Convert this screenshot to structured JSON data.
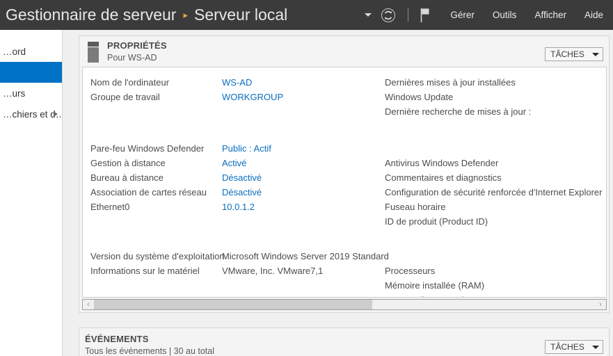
{
  "header": {
    "app_title": "Gestionnaire de serveur",
    "separator": "▸",
    "current_page": "Serveur local",
    "icons": {
      "caret": "chevron-down-icon",
      "refresh": "refresh-icon",
      "flag": "notifications-flag-icon"
    },
    "menu": [
      {
        "label": "Gérer"
      },
      {
        "label": "Outils"
      },
      {
        "label": "Afficher"
      },
      {
        "label": "Aide"
      }
    ]
  },
  "sidebar": {
    "items": [
      {
        "label": "…ord",
        "selected": false,
        "has_arrow": false
      },
      {
        "label": "",
        "selected": true,
        "has_arrow": false
      },
      {
        "label": "…urs",
        "selected": false,
        "has_arrow": false
      },
      {
        "label": "…chiers et d…",
        "selected": false,
        "has_arrow": true
      }
    ]
  },
  "properties_tile": {
    "title": "PROPRIÉTÉS",
    "subtitle": "Pour WS-AD",
    "tasks_label": "TÂCHES",
    "left_column": [
      [
        {
          "key": "Nom de l'ordinateur",
          "value": "WS-AD",
          "link": true
        },
        {
          "key": "Groupe de travail",
          "value": "WORKGROUP",
          "link": true
        }
      ],
      [
        {
          "key": "Pare-feu Windows Defender",
          "value": "Public : Actif",
          "link": true
        },
        {
          "key": "Gestion à distance",
          "value": "Activé",
          "link": true
        },
        {
          "key": "Bureau à distance",
          "value": "Désactivé",
          "link": true
        },
        {
          "key": "Association de cartes réseau",
          "value": "Désactivé",
          "link": true
        },
        {
          "key": "Ethernet0",
          "value": "10.0.1.2",
          "link": true
        }
      ],
      [
        {
          "key": "Version du système d'exploitation",
          "value": "Microsoft Windows Server 2019 Standard",
          "link": false
        },
        {
          "key": "Informations sur le matériel",
          "value": "VMware, Inc. VMware7,1",
          "link": false
        }
      ]
    ],
    "right_column": [
      [
        {
          "key": "Dernières mises à jour installées",
          "value": "",
          "link": true
        },
        {
          "key": "Windows Update",
          "value": "",
          "link": true
        },
        {
          "key": "Dernière recherche de mises à jour :",
          "value": "",
          "link": true
        }
      ],
      [
        {
          "key": "Antivirus Windows Defender",
          "value": "",
          "link": true
        },
        {
          "key": "Commentaires et diagnostics",
          "value": "",
          "link": true
        },
        {
          "key": "Configuration de sécurité renforcée d'Internet Explorer",
          "value": "",
          "link": true
        },
        {
          "key": "Fuseau horaire",
          "value": "",
          "link": true
        },
        {
          "key": "ID de produit (Product ID)",
          "value": "",
          "link": true
        }
      ],
      [
        {
          "key": "Processeurs",
          "value": "",
          "link": false
        },
        {
          "key": "Mémoire installée (RAM)",
          "value": "",
          "link": false
        },
        {
          "key": "Espace disque total",
          "value": "",
          "link": false
        }
      ]
    ],
    "scrollbar": {
      "left_arrow": "‹",
      "right_arrow": "›",
      "thumb_percent": 55.5
    }
  },
  "events_tile": {
    "title": "ÉVÉNEMENTS",
    "subtitle": "Tous les événements | 30 au total",
    "tasks_label": "TÂCHES"
  },
  "colors": {
    "header_bg": "#3b3b3b",
    "accent_selected": "#0072c6",
    "link": "#0a6ebd",
    "breadcrumb_arrow": "#e8a33d"
  }
}
